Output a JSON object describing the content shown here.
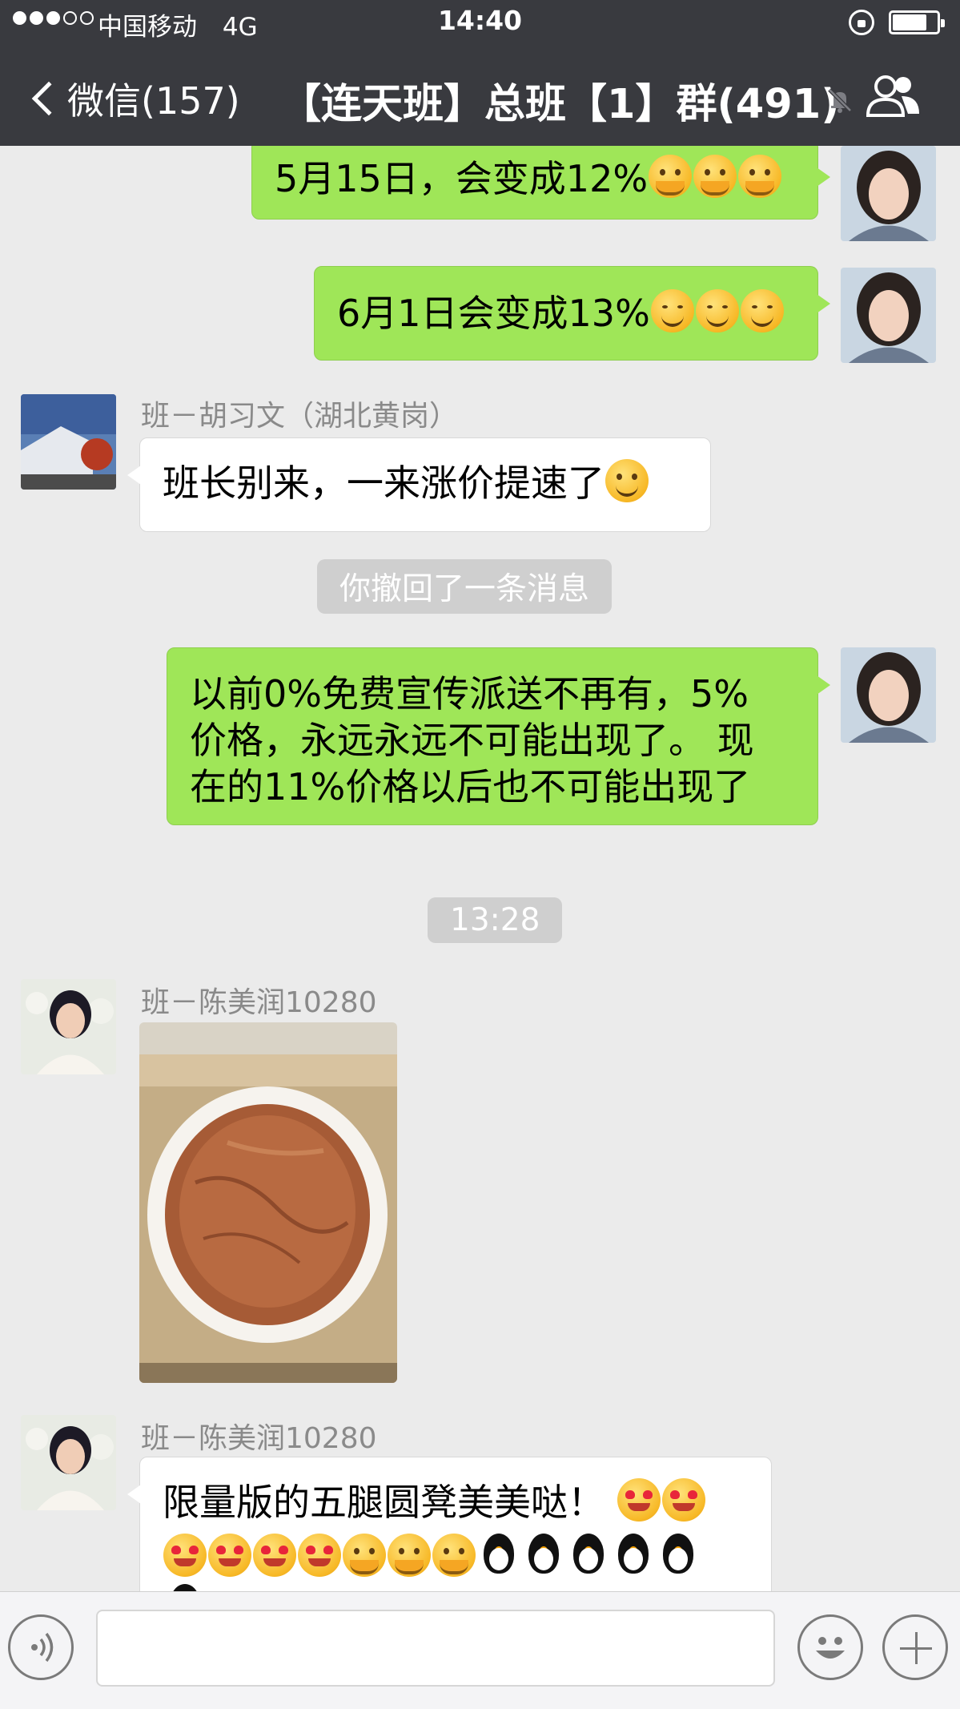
{
  "status_bar": {
    "carrier": "中国移动",
    "network": "4G",
    "time": "14:40",
    "battery_level": 0.75
  },
  "nav": {
    "back_label": "微信(157)",
    "title": "【连天班】总班【1】群(491)",
    "icons": [
      "chevron-left-icon",
      "mute-bell-icon",
      "group-members-icon"
    ]
  },
  "messages": [
    {
      "type": "out",
      "text": "5月15日，会变成12%",
      "emoji": [
        "hug",
        "hug",
        "hug"
      ]
    },
    {
      "type": "out",
      "text": "6月1日会变成13%",
      "emoji": [
        "smirk",
        "smirk",
        "smirk"
      ]
    },
    {
      "type": "in",
      "sender": "班－胡习文（湖北黄岗）",
      "text": "班长别来，一来涨价提速了",
      "emoji": [
        "grin"
      ]
    },
    {
      "type": "system",
      "text": "你撤回了一条消息"
    },
    {
      "type": "out",
      "lines": [
        "以前0%免费宣传派送不再有，5%",
        "价格，永远永远不可能出现了。 现",
        "在的11%价格以后也不可能出现了"
      ]
    },
    {
      "type": "timestamp",
      "text": "13:28"
    },
    {
      "type": "in-image",
      "sender": "班－陈美润10280",
      "image": "round wooden stool top in box"
    },
    {
      "type": "in",
      "sender": "班－陈美润10280",
      "text": "限量版的五腿圆凳美美哒！",
      "emoji": [
        "heart-eyes",
        "heart-eyes",
        "heart-eyes",
        "heart-eyes",
        "heart-eyes",
        "heart-eyes",
        "hug",
        "hug",
        "hug",
        "penguin",
        "penguin",
        "penguin",
        "penguin",
        "penguin",
        "penguin"
      ]
    }
  ],
  "input_bar": {
    "icons": [
      "voice-icon",
      "emoji-icon",
      "plus-icon"
    ],
    "value": ""
  },
  "colors": {
    "nav_bg": "#393a3f",
    "chat_bg": "#ebebeb",
    "outgoing_bubble": "#9fe658",
    "incoming_bubble": "#ffffff"
  }
}
